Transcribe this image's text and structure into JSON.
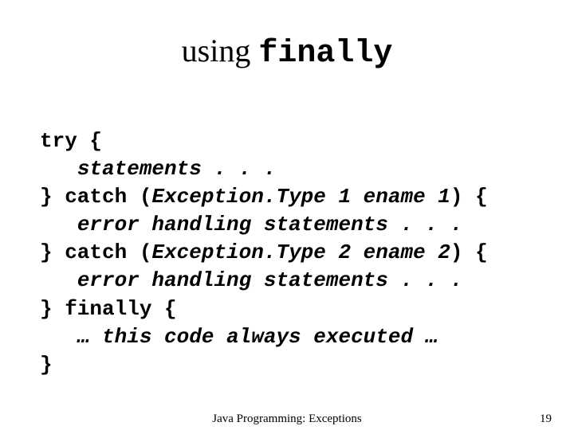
{
  "title": {
    "word1": "using ",
    "word2": "finally"
  },
  "code": {
    "l1a": "try {",
    "l2a": "   ",
    "l2b": "statements . . .",
    "l3a": "} catch (",
    "l3b": "Exception.Type 1 ename 1",
    "l3c": ") {",
    "l4a": "   ",
    "l4b": "error handling statements . . .",
    "l5a": "} catch (",
    "l5b": "Exception.Type 2 ename 2",
    "l5c": ") {",
    "l6a": "   ",
    "l6b": "error handling statements . . .",
    "l7a": "} finally {",
    "l8a": "   ",
    "l8b": "… this code always executed …",
    "l9a": "}"
  },
  "footer": {
    "center": "Java Programming: Exceptions",
    "page": "19"
  }
}
